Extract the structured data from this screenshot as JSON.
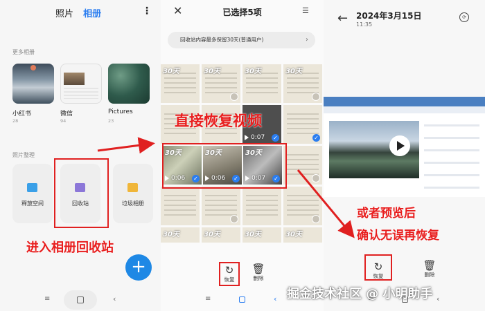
{
  "colors": {
    "accent": "#2a7df0",
    "annotation_red": "#e02020",
    "fab": "#1e88e5"
  },
  "gallery": {
    "tab_photos": "照片",
    "tab_albums": "相册",
    "more_icon": "more-vertical-icon",
    "more_albums_label": "更多相册",
    "albums": [
      {
        "name": "小红书",
        "count": "28"
      },
      {
        "name": "微信",
        "count": "94"
      },
      {
        "name": "Pictures",
        "count": "23"
      }
    ],
    "organize_label": "照片整理",
    "tools": [
      {
        "label": "释放空间",
        "icon": "broom-icon"
      },
      {
        "label": "回收站",
        "icon": "trash-icon"
      },
      {
        "label": "垃圾相册",
        "icon": "folder-icon"
      }
    ],
    "fab_label": "+",
    "caption": "进入相册回收站"
  },
  "recycle": {
    "title": "已选择5项",
    "banner": "回收站内容最多保留30天(普通用户)",
    "badge": "30天",
    "caption": "直接恢复视频",
    "durations": [
      "0:07",
      "0:06",
      "0:06",
      "0:07"
    ],
    "actions": [
      {
        "label": "恢复",
        "icon": "restore-icon"
      },
      {
        "label": "删除",
        "icon": "trash-icon"
      }
    ]
  },
  "preview": {
    "date": "2024年3月15日",
    "time": "11:35",
    "caption_line1": "或者预览后",
    "caption_line2": "确认无误再恢复",
    "actions": [
      {
        "label": "恢复",
        "icon": "restore-icon"
      },
      {
        "label": "删除",
        "icon": "trash-icon"
      }
    ]
  },
  "watermark": "掘金技术社区 @ 小明助手"
}
